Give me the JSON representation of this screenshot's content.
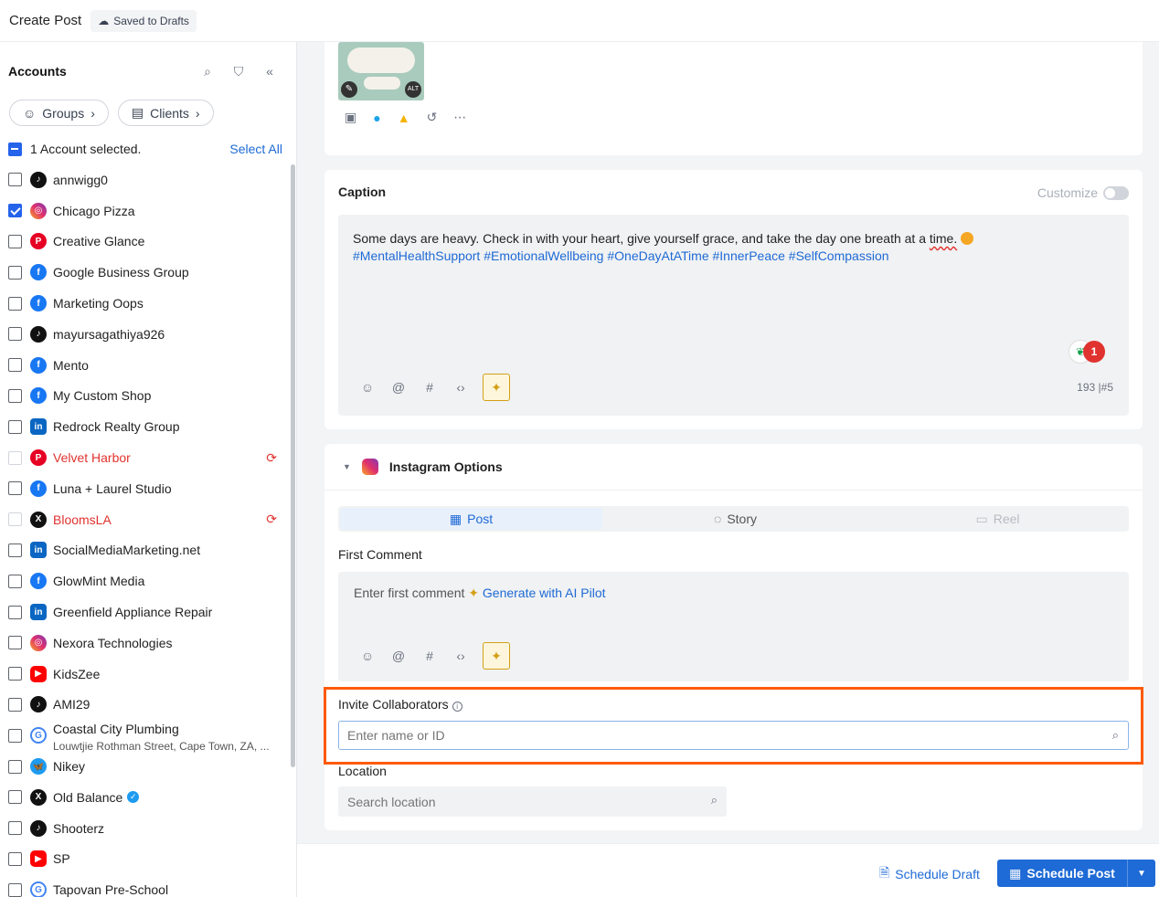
{
  "header": {
    "title": "Create Post",
    "saved_status": "Saved to Drafts"
  },
  "sidebar": {
    "heading": "Accounts",
    "chips": {
      "groups": "Groups",
      "clients": "Clients"
    },
    "selection_text": "1 Account selected.",
    "select_all": "Select All",
    "accounts": [
      {
        "name": "annwigg0",
        "platform": "tiktok",
        "checked": false
      },
      {
        "name": "Chicago Pizza",
        "platform": "instagram",
        "checked": true
      },
      {
        "name": "Creative Glance",
        "platform": "pinterest",
        "checked": false
      },
      {
        "name": "Google Business Group",
        "platform": "facebook",
        "checked": false
      },
      {
        "name": "Marketing Oops",
        "platform": "facebook",
        "checked": false
      },
      {
        "name": "mayursagathiya926",
        "platform": "tiktok",
        "checked": false
      },
      {
        "name": "Mento",
        "platform": "facebook",
        "checked": false
      },
      {
        "name": "My Custom Shop",
        "platform": "facebook",
        "checked": false
      },
      {
        "name": "Redrock Realty Group",
        "platform": "linkedin",
        "checked": false
      },
      {
        "name": "Velvet Harbor",
        "platform": "pinterest",
        "checked": false,
        "error": true
      },
      {
        "name": "Luna + Laurel Studio",
        "platform": "facebook",
        "checked": false
      },
      {
        "name": "BloomsLA",
        "platform": "x",
        "checked": false,
        "error": true
      },
      {
        "name": "SocialMediaMarketing.net",
        "platform": "linkedin",
        "checked": false
      },
      {
        "name": "GlowMint Media",
        "platform": "facebook",
        "checked": false
      },
      {
        "name": "Greenfield Appliance Repair",
        "platform": "linkedin",
        "checked": false
      },
      {
        "name": "Nexora Technologies",
        "platform": "instagram",
        "checked": false
      },
      {
        "name": "KidsZee",
        "platform": "youtube",
        "checked": false
      },
      {
        "name": "AMI29",
        "platform": "tiktok",
        "checked": false
      },
      {
        "name": "Coastal City Plumbing",
        "sub": "Louwtjie Rothman Street, Cape Town, ZA, ...",
        "platform": "google",
        "checked": false
      },
      {
        "name": "Nikey",
        "platform": "bluesky",
        "checked": false
      },
      {
        "name": "Old Balance",
        "platform": "x",
        "checked": false,
        "verified": true
      },
      {
        "name": "Shooterz",
        "platform": "tiktok",
        "checked": false
      },
      {
        "name": "SP",
        "platform": "youtube",
        "checked": false
      },
      {
        "name": "Tapovan Pre-School",
        "platform": "google",
        "checked": false
      }
    ]
  },
  "media": {
    "thumb_alt_badge": "ALT"
  },
  "caption": {
    "title": "Caption",
    "customize_label": "Customize",
    "text_start": "Some days are heavy. Check in with your heart, give yourself grace, and take the day one breath at a ",
    "text_underlined": "time.",
    "hashtags": "#MentalHealthSupport #EmotionalWellbeing #OneDayAtATime #InnerPeace #SelfCompassion",
    "grammar_count": "1",
    "char_count": "193 |#5"
  },
  "instagram_options": {
    "title": "Instagram Options",
    "tabs": [
      "Post",
      "Story",
      "Reel"
    ],
    "first_comment_label": "First Comment",
    "first_comment_placeholder": "Enter first comment",
    "generate_ai": "Generate with AI Pilot",
    "invite_label": "Invite Collaborators",
    "invite_placeholder": "Enter name or ID",
    "location_label": "Location",
    "location_placeholder": "Search location"
  },
  "footer": {
    "schedule_draft": "Schedule Draft",
    "schedule_post": "Schedule Post"
  },
  "colors": {
    "accent": "#1e6ad6",
    "error": "#e0332f",
    "highlight": "#ff5a0a"
  }
}
